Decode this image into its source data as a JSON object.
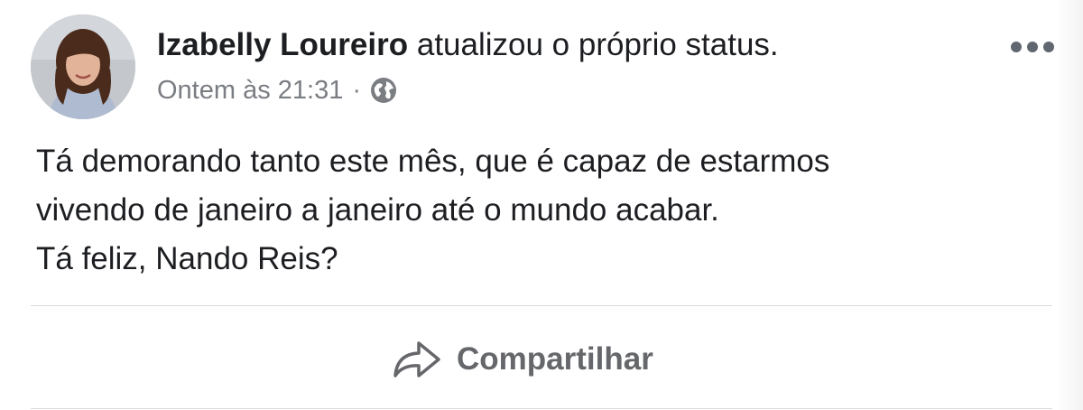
{
  "post": {
    "author_name": "Izabelly Loureiro",
    "action_text": " atualizou o próprio status.",
    "timestamp": "Ontem às 21:31",
    "meta_separator": "·",
    "privacy_icon": "globe-icon",
    "more_icon": "more-horizontal-icon",
    "text_lines": [
      "Tá demorando tanto este mês, que é capaz de estarmos",
      "vivendo de janeiro a janeiro até o mundo acabar.",
      "Tá feliz, Nando Reis?"
    ]
  },
  "actions": {
    "share_label": "Compartilhar",
    "share_icon": "share-arrow-icon"
  },
  "colors": {
    "text_primary": "#1c1e21",
    "text_secondary": "#7a7d82",
    "action_gray": "#65676b",
    "divider": "#d8dadf"
  }
}
